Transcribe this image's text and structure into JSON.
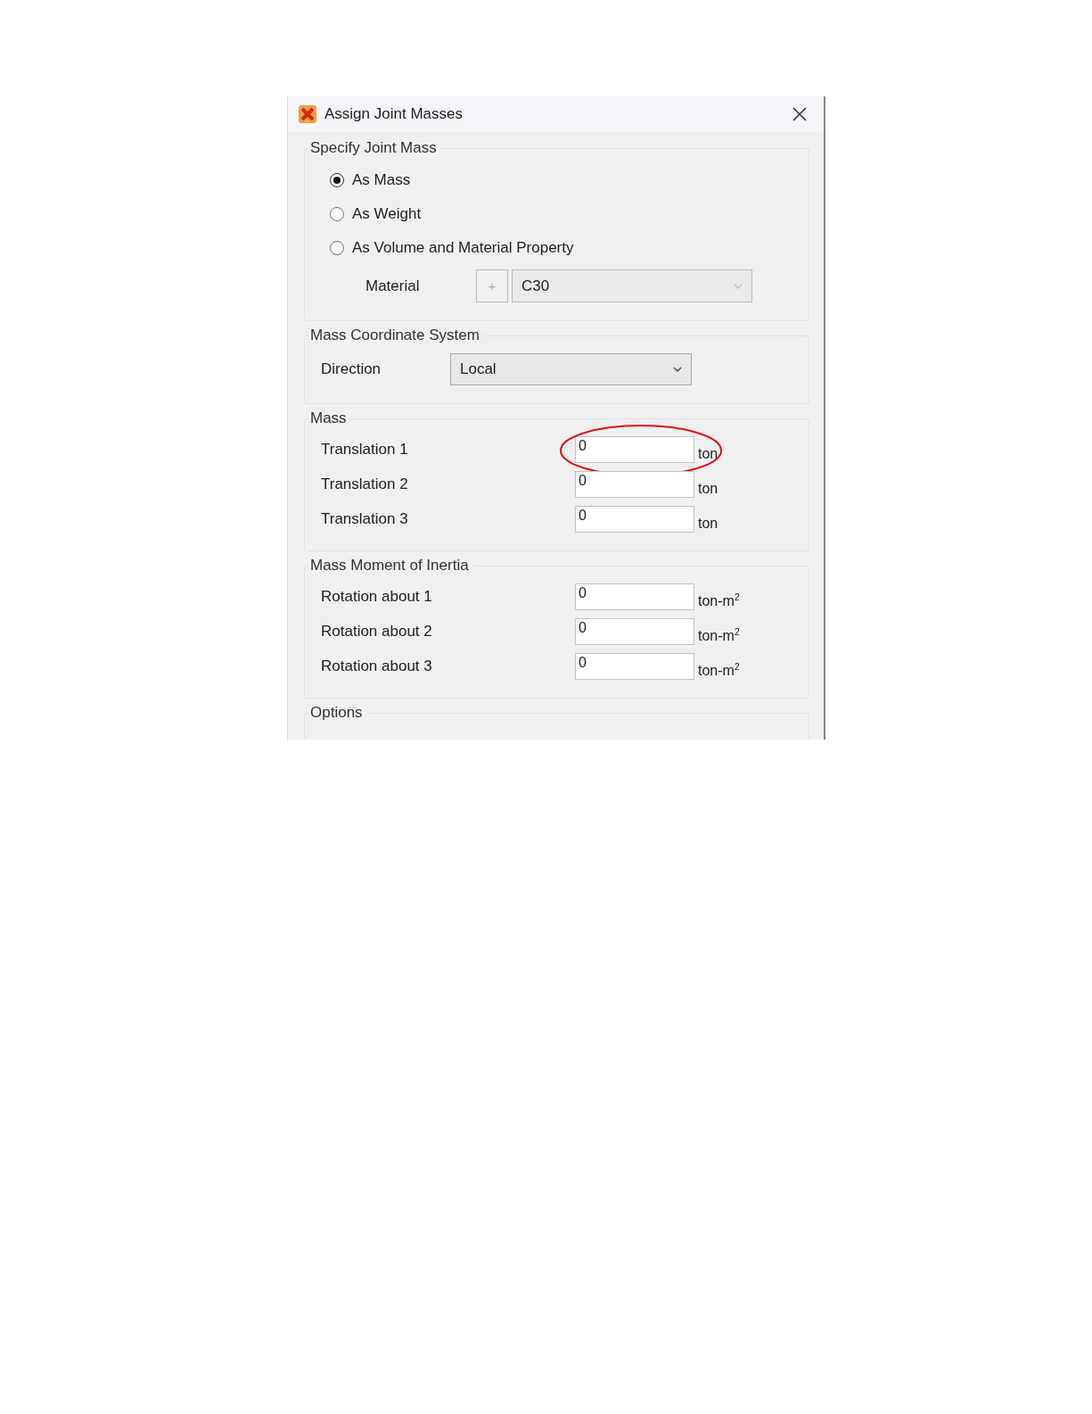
{
  "window": {
    "title": "Assign Joint Masses"
  },
  "specify_joint_mass": {
    "title": "Specify Joint Mass",
    "options": [
      {
        "label": "As Mass",
        "selected": true
      },
      {
        "label": "As Weight",
        "selected": false
      },
      {
        "label": "As Volume and Material Property",
        "selected": false
      }
    ],
    "material": {
      "label": "Material",
      "button": "+",
      "value": "C30",
      "disabled": true
    }
  },
  "mass_coordinate_system": {
    "title": "Mass Coordinate System",
    "direction": {
      "label": "Direction",
      "value": "Local"
    }
  },
  "mass": {
    "title": "Mass",
    "rows": [
      {
        "label": "Translation 1",
        "value": "0",
        "unit": "ton",
        "highlighted": true
      },
      {
        "label": "Translation 2",
        "value": "0",
        "unit": "ton",
        "highlighted": false
      },
      {
        "label": "Translation 3",
        "value": "0",
        "unit": "ton",
        "highlighted": false
      }
    ]
  },
  "mass_moment_of_inertia": {
    "title": "Mass Moment of Inertia",
    "rows": [
      {
        "label": "Rotation about 1",
        "value": "0",
        "unit": "ton-m$^{2}$",
        "highlighted": false
      },
      {
        "label": "Rotation about 2",
        "value": "0",
        "unit": "ton-m$^{2}$",
        "highlighted": false
      },
      {
        "label": "Rotation about 3",
        "value": "0",
        "unit": "ton-m$^{2}$",
        "highlighted": false
      }
    ]
  },
  "options": {
    "title": "Options"
  }
}
